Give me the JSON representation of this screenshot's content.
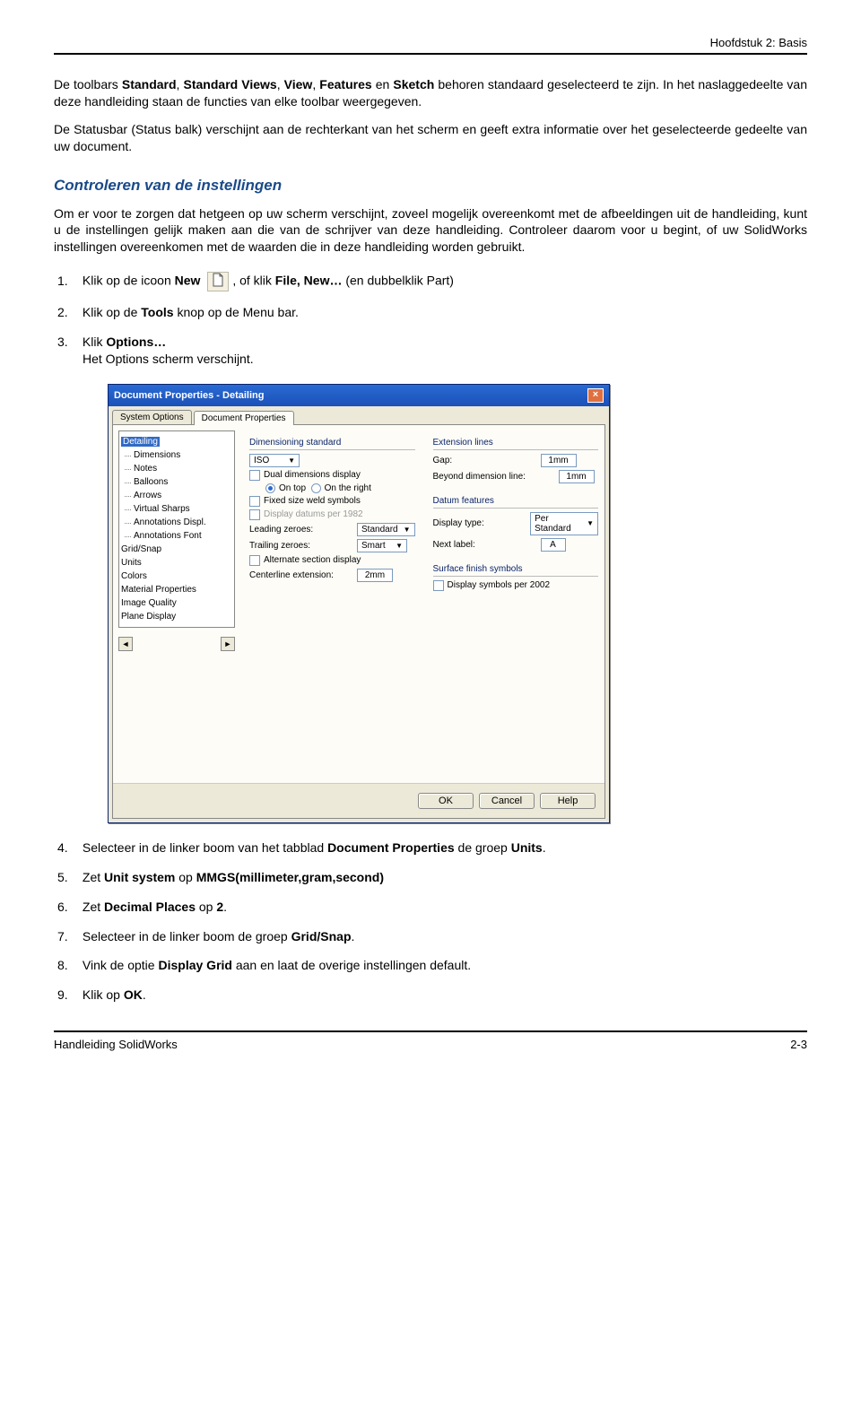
{
  "page": {
    "header": "Hoofdstuk 2: Basis",
    "footer_left": "Handleiding SolidWorks",
    "footer_right": "2-3"
  },
  "intro": {
    "p1a": "De toolbars ",
    "p1b": "Standard",
    "p1c": ", ",
    "p1d": "Standard Views",
    "p1e": ", ",
    "p1f": "View",
    "p1g": ", ",
    "p1h": "Features",
    "p1i": " en ",
    "p1j": "Sketch",
    "p1k": " behoren standaard geselecteerd te zijn. In het naslaggedeelte van deze handleiding staan de functies van elke toolbar weergegeven.",
    "p2": "De Statusbar (Status balk) verschijnt aan de rechterkant van het scherm en geeft extra informatie over het geselecteerde gedeelte van uw document."
  },
  "section": {
    "heading": "Controleren van de instellingen",
    "body": "Om er voor te zorgen dat hetgeen op uw scherm verschijnt, zoveel mogelijk overeenkomt met de afbeeldingen uit de handleiding, kunt u de instellingen gelijk maken aan die van de schrijver van deze handleiding. Controleer daarom voor u begint, of uw SolidWorks instellingen overeenkomen met de waarden die in deze handleiding worden gebruikt."
  },
  "steps": {
    "s1a": "Klik op de icoon ",
    "s1b": "New",
    "s1c": ", of klik ",
    "s1d": "File, New…",
    "s1e": " (en dubbelklik Part)",
    "s2a": "Klik op de ",
    "s2b": "Tools",
    "s2c": " knop op de Menu bar.",
    "s3a": "Klik ",
    "s3b": "Options…",
    "s3c": "Het Options scherm verschijnt.",
    "s4a": "Selecteer in de linker boom van het tabblad ",
    "s4b": "Document Properties",
    "s4c": " de groep ",
    "s4d": "Units",
    "s4e": ".",
    "s5a": "Zet ",
    "s5b": "Unit system",
    "s5c": " op ",
    "s5d": "MMGS(millimeter,gram,second)",
    "s6a": "Zet ",
    "s6b": "Decimal Places",
    "s6c": " op ",
    "s6d": "2",
    "s6e": ".",
    "s7a": "Selecteer in de linker boom de groep ",
    "s7b": "Grid/Snap",
    "s7c": ".",
    "s8a": "Vink de optie ",
    "s8b": "Display Grid",
    "s8c": " aan en laat de overige instellingen default.",
    "s9a": "Klik op ",
    "s9b": "OK",
    "s9c": "."
  },
  "dialog": {
    "title": "Document Properties - Detailing",
    "tabs": [
      "System Options",
      "Document Properties"
    ],
    "tree": [
      "Detailing",
      "Dimensions",
      "Notes",
      "Balloons",
      "Arrows",
      "Virtual Sharps",
      "Annotations Displ.",
      "Annotations Font",
      "Grid/Snap",
      "Units",
      "Colors",
      "Material Properties",
      "Image Quality",
      "Plane Display"
    ],
    "left": {
      "dim_std_label": "Dimensioning standard",
      "dim_std_value": "ISO",
      "dual_dim": "Dual dimensions display",
      "on_top": "On top",
      "on_right": "On the right",
      "fixed_weld": "Fixed size weld symbols",
      "display_1982": "Display datums per 1982",
      "leading_label": "Leading zeroes:",
      "leading_value": "Standard",
      "trailing_label": "Trailing zeroes:",
      "trailing_value": "Smart",
      "alt_section": "Alternate section display",
      "centerline_label": "Centerline extension:",
      "centerline_value": "2mm"
    },
    "right": {
      "ext_lines": "Extension lines",
      "gap_label": "Gap:",
      "gap_value": "1mm",
      "beyond_label": "Beyond dimension line:",
      "beyond_value": "1mm",
      "datum_features": "Datum features",
      "display_type_label": "Display type:",
      "display_type_value": "Per Standard",
      "next_label_label": "Next label:",
      "next_label_value": "A",
      "surface_finish": "Surface finish symbols",
      "display_2002": "Display symbols per 2002"
    },
    "buttons": {
      "ok": "OK",
      "cancel": "Cancel",
      "help": "Help"
    }
  }
}
